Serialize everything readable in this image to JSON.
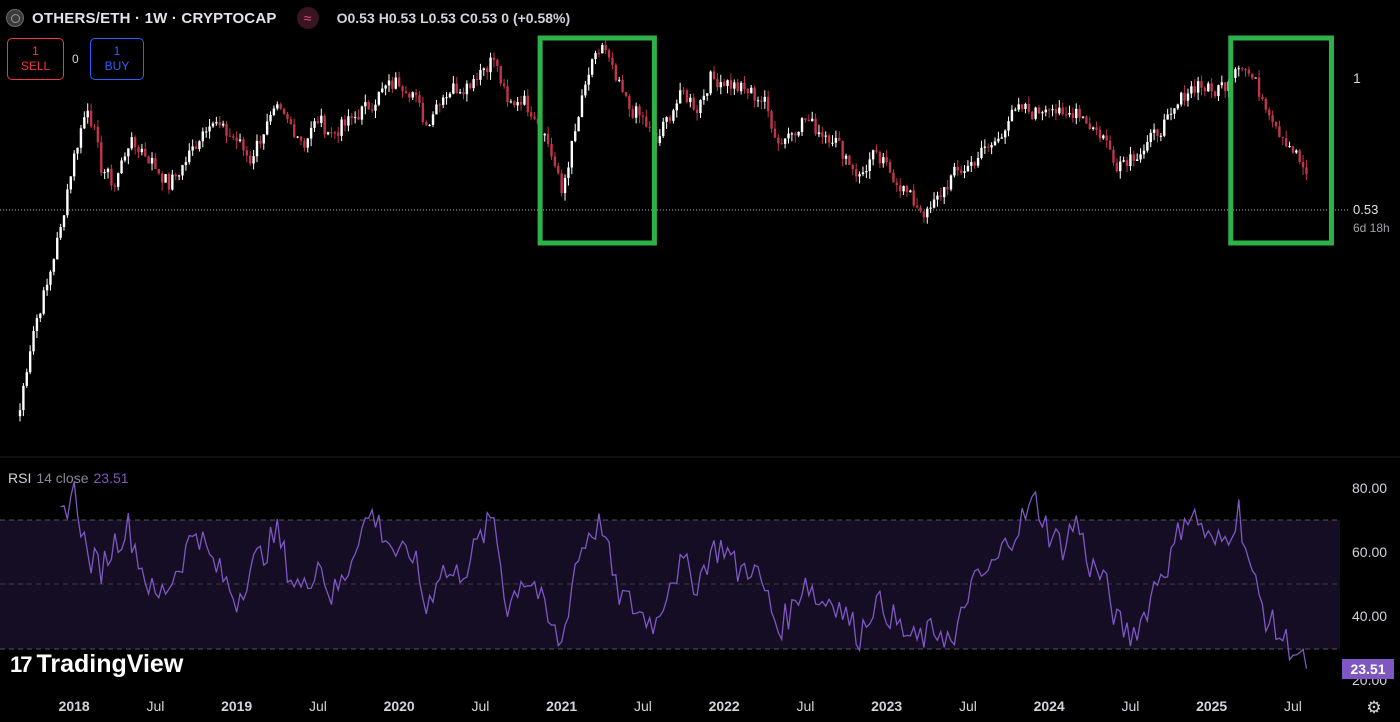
{
  "header": {
    "title": "OTHERS/ETH · 1W · CRYPTOCAP",
    "ohlc": {
      "open_label": "O",
      "open": "0.53",
      "high_label": "H",
      "high": "0.53",
      "low_label": "L",
      "low": "0.53",
      "close_label": "C",
      "close": "0.53",
      "change": "0 (+0.58%)"
    }
  },
  "trade": {
    "sell_count": "1",
    "sell_label": "SELL",
    "spread": "0",
    "buy_count": "1",
    "buy_label": "BUY"
  },
  "rsi_label": {
    "name": "RSI",
    "params": "14 close",
    "value": "23.51"
  },
  "price_tag": {
    "price": "0.53",
    "countdown": "6d 18h"
  },
  "rsi_tag": "23.51",
  "price_axis_label": "1",
  "branding": "TradingView",
  "colors": {
    "up": "#ffffff",
    "down": "#c0354a",
    "rsi_line": "#7e57c2",
    "rsi_band": "#150d24",
    "highlight_box": "#2fb14a",
    "background": "#000000"
  },
  "icons": {
    "symbol": "symbol-logo-icon",
    "indicator": "wave-icon",
    "settings": "gear-icon"
  },
  "chart_data": [
    {
      "type": "candlestick",
      "title": "OTHERS/ETH · 1W · CRYPTOCAP",
      "x_range": [
        "2017-09",
        "2025-09"
      ],
      "y_label": "",
      "close_path": [
        [
          "2017-09",
          0.16
        ],
        [
          "2017-10",
          0.24
        ],
        [
          "2017-11",
          0.3
        ],
        [
          "2017-12",
          0.4
        ],
        [
          "2018-01",
          0.58
        ],
        [
          "2018-02",
          0.75
        ],
        [
          "2018-03",
          0.55
        ],
        [
          "2018-04",
          0.5
        ],
        [
          "2018-05",
          0.62
        ],
        [
          "2018-06",
          0.6
        ],
        [
          "2018-07",
          0.55
        ],
        [
          "2018-08",
          0.5
        ],
        [
          "2018-09",
          0.55
        ],
        [
          "2018-10",
          0.62
        ],
        [
          "2018-11",
          0.7
        ],
        [
          "2018-12",
          0.66
        ],
        [
          "2019-01",
          0.63
        ],
        [
          "2019-02",
          0.57
        ],
        [
          "2019-03",
          0.66
        ],
        [
          "2019-04",
          0.73
        ],
        [
          "2019-05",
          0.68
        ],
        [
          "2019-06",
          0.62
        ],
        [
          "2019-07",
          0.7
        ],
        [
          "2019-08",
          0.65
        ],
        [
          "2019-09",
          0.68
        ],
        [
          "2019-10",
          0.72
        ],
        [
          "2019-11",
          0.76
        ],
        [
          "2019-12",
          0.82
        ],
        [
          "2020-01",
          0.85
        ],
        [
          "2020-02",
          0.8
        ],
        [
          "2020-03",
          0.68
        ],
        [
          "2020-04",
          0.78
        ],
        [
          "2020-05",
          0.82
        ],
        [
          "2020-06",
          0.83
        ],
        [
          "2020-07",
          0.9
        ],
        [
          "2020-08",
          0.95
        ],
        [
          "2020-09",
          0.75
        ],
        [
          "2020-10",
          0.78
        ],
        [
          "2020-11",
          0.72
        ],
        [
          "2020-12",
          0.62
        ],
        [
          "2021-01",
          0.48
        ],
        [
          "2021-02",
          0.65
        ],
        [
          "2021-03",
          0.88
        ],
        [
          "2021-04",
          1.02
        ],
        [
          "2021-05",
          0.85
        ],
        [
          "2021-06",
          0.74
        ],
        [
          "2021-07",
          0.7
        ],
        [
          "2021-08",
          0.62
        ],
        [
          "2021-09",
          0.72
        ],
        [
          "2021-10",
          0.8
        ],
        [
          "2021-11",
          0.74
        ],
        [
          "2021-12",
          0.86
        ],
        [
          "2022-01",
          0.85
        ],
        [
          "2022-02",
          0.82
        ],
        [
          "2022-03",
          0.8
        ],
        [
          "2022-04",
          0.76
        ],
        [
          "2022-05",
          0.62
        ],
        [
          "2022-06",
          0.66
        ],
        [
          "2022-07",
          0.7
        ],
        [
          "2022-08",
          0.66
        ],
        [
          "2022-09",
          0.64
        ],
        [
          "2022-10",
          0.58
        ],
        [
          "2022-11",
          0.52
        ],
        [
          "2022-12",
          0.58
        ],
        [
          "2023-01",
          0.55
        ],
        [
          "2023-02",
          0.5
        ],
        [
          "2023-03",
          0.46
        ],
        [
          "2023-04",
          0.43
        ],
        [
          "2023-05",
          0.48
        ],
        [
          "2023-06",
          0.53
        ],
        [
          "2023-07",
          0.55
        ],
        [
          "2023-08",
          0.59
        ],
        [
          "2023-09",
          0.62
        ],
        [
          "2023-10",
          0.7
        ],
        [
          "2023-11",
          0.74
        ],
        [
          "2023-12",
          0.72
        ],
        [
          "2024-01",
          0.76
        ],
        [
          "2024-02",
          0.7
        ],
        [
          "2024-03",
          0.74
        ],
        [
          "2024-04",
          0.68
        ],
        [
          "2024-05",
          0.64
        ],
        [
          "2024-06",
          0.56
        ],
        [
          "2024-07",
          0.58
        ],
        [
          "2024-08",
          0.6
        ],
        [
          "2024-09",
          0.66
        ],
        [
          "2024-10",
          0.7
        ],
        [
          "2024-11",
          0.8
        ],
        [
          "2024-12",
          0.84
        ],
        [
          "2025-01",
          0.8
        ],
        [
          "2025-02",
          0.84
        ],
        [
          "2025-03",
          0.94
        ],
        [
          "2025-04",
          0.86
        ],
        [
          "2025-05",
          0.76
        ],
        [
          "2025-06",
          0.66
        ],
        [
          "2025-07",
          0.6
        ],
        [
          "2025-08",
          0.53
        ]
      ],
      "last_price": 0.53,
      "highlight_boxes": [
        [
          "2020-12",
          "2021-06"
        ],
        [
          "2025-03",
          "2025-08"
        ]
      ],
      "y_tick_labels": [
        "1"
      ]
    },
    {
      "type": "line",
      "title": "RSI 14 close",
      "ylim": [
        20,
        80
      ],
      "y_ticks": [
        "80.00",
        "60.00",
        "40.00",
        "20.00"
      ],
      "band": [
        30,
        70
      ],
      "last_value": 23.51,
      "series": [
        {
          "name": "RSI",
          "points": [
            [
              "2017-12",
              70
            ],
            [
              "2018-01",
              80
            ],
            [
              "2018-02",
              58
            ],
            [
              "2018-03",
              55
            ],
            [
              "2018-04",
              63
            ],
            [
              "2018-05",
              68
            ],
            [
              "2018-06",
              55
            ],
            [
              "2018-07",
              45
            ],
            [
              "2018-08",
              50
            ],
            [
              "2018-09",
              58
            ],
            [
              "2018-10",
              68
            ],
            [
              "2018-11",
              58
            ],
            [
              "2018-12",
              52
            ],
            [
              "2019-01",
              45
            ],
            [
              "2019-02",
              55
            ],
            [
              "2019-03",
              60
            ],
            [
              "2019-04",
              66
            ],
            [
              "2019-05",
              52
            ],
            [
              "2019-06",
              48
            ],
            [
              "2019-07",
              58
            ],
            [
              "2019-08",
              46
            ],
            [
              "2019-09",
              52
            ],
            [
              "2019-10",
              66
            ],
            [
              "2019-11",
              72
            ],
            [
              "2019-12",
              65
            ],
            [
              "2020-01",
              58
            ],
            [
              "2020-02",
              60
            ],
            [
              "2020-03",
              42
            ],
            [
              "2020-04",
              55
            ],
            [
              "2020-05",
              52
            ],
            [
              "2020-06",
              56
            ],
            [
              "2020-07",
              64
            ],
            [
              "2020-08",
              71
            ],
            [
              "2020-09",
              42
            ],
            [
              "2020-10",
              52
            ],
            [
              "2020-11",
              50
            ],
            [
              "2020-12",
              38
            ],
            [
              "2021-01",
              31
            ],
            [
              "2021-02",
              56
            ],
            [
              "2021-03",
              66
            ],
            [
              "2021-04",
              69
            ],
            [
              "2021-05",
              48
            ],
            [
              "2021-06",
              44
            ],
            [
              "2021-07",
              40
            ],
            [
              "2021-08",
              38
            ],
            [
              "2021-09",
              52
            ],
            [
              "2021-10",
              56
            ],
            [
              "2021-11",
              50
            ],
            [
              "2021-12",
              60
            ],
            [
              "2022-01",
              62
            ],
            [
              "2022-02",
              54
            ],
            [
              "2022-03",
              56
            ],
            [
              "2022-04",
              48
            ],
            [
              "2022-05",
              36
            ],
            [
              "2022-06",
              42
            ],
            [
              "2022-07",
              52
            ],
            [
              "2022-08",
              44
            ],
            [
              "2022-09",
              46
            ],
            [
              "2022-10",
              40
            ],
            [
              "2022-11",
              34
            ],
            [
              "2022-12",
              44
            ],
            [
              "2023-01",
              42
            ],
            [
              "2023-02",
              36
            ],
            [
              "2023-03",
              32
            ],
            [
              "2023-04",
              34
            ],
            [
              "2023-05",
              36
            ],
            [
              "2023-06",
              30
            ],
            [
              "2023-07",
              48
            ],
            [
              "2023-08",
              52
            ],
            [
              "2023-09",
              56
            ],
            [
              "2023-10",
              64
            ],
            [
              "2023-11",
              70
            ],
            [
              "2023-12",
              76
            ],
            [
              "2024-01",
              66
            ],
            [
              "2024-02",
              62
            ],
            [
              "2024-03",
              70
            ],
            [
              "2024-04",
              56
            ],
            [
              "2024-05",
              52
            ],
            [
              "2024-06",
              38
            ],
            [
              "2024-07",
              34
            ],
            [
              "2024-08",
              40
            ],
            [
              "2024-09",
              52
            ],
            [
              "2024-10",
              58
            ],
            [
              "2024-11",
              72
            ],
            [
              "2024-12",
              70
            ],
            [
              "2025-01",
              62
            ],
            [
              "2025-02",
              64
            ],
            [
              "2025-03",
              73
            ],
            [
              "2025-04",
              52
            ],
            [
              "2025-05",
              40
            ],
            [
              "2025-06",
              34
            ],
            [
              "2025-07",
              30
            ],
            [
              "2025-08",
              23.51
            ]
          ]
        }
      ],
      "x_tick_labels": [
        "2018",
        "Jul",
        "2019",
        "Jul",
        "2020",
        "Jul",
        "2021",
        "Jul",
        "2022",
        "Jul",
        "2023",
        "Jul",
        "2024",
        "Jul",
        "2025",
        "Jul"
      ]
    }
  ]
}
